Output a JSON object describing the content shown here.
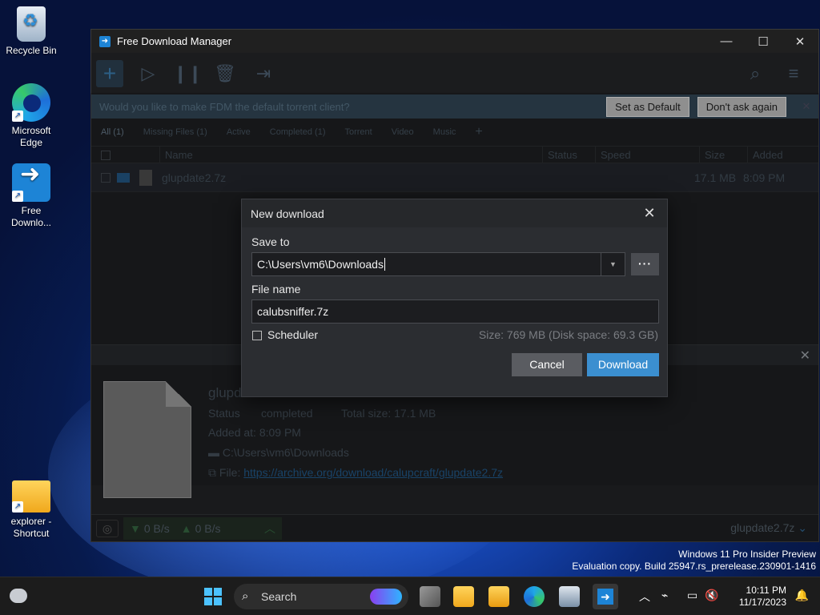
{
  "desktop": {
    "icons": [
      {
        "label": "Recycle Bin"
      },
      {
        "label": "Microsoft Edge"
      },
      {
        "label": "Free Downlo..."
      },
      {
        "label": "explorer - Shortcut"
      }
    ]
  },
  "window": {
    "title": "Free Download Manager",
    "notice": {
      "message": "Would you like to make FDM the default torrent client?",
      "set_default": "Set as Default",
      "dont_ask": "Don't ask again"
    },
    "tabs": [
      "All (1)",
      "Missing Files (1)",
      "Active",
      "Completed (1)",
      "Torrent",
      "Video",
      "Music"
    ],
    "columns": {
      "name": "Name",
      "status": "Status",
      "speed": "Speed",
      "size": "Size",
      "added": "Added"
    },
    "row": {
      "name": "glupdate2.7z",
      "size": "17.1 MB",
      "added": "8:09 PM"
    },
    "details": {
      "name": "glupdate2.7z",
      "status_label": "Status",
      "status_value": "completed",
      "total_size": "Total size: 17.1 MB",
      "added_at": "Added at: 8:09 PM",
      "path": "C:\\Users\\vm6\\Downloads",
      "file_label": "File:",
      "file_url": "https://archive.org/download/calupcraft/glupdate2.7z"
    },
    "status": {
      "down": "0 B/s",
      "up": "0 B/s",
      "current": "glupdate2.7z"
    }
  },
  "dialog": {
    "title": "New download",
    "save_to_label": "Save to",
    "save_to_value": "C:\\Users\\vm6\\Downloads",
    "file_name_label": "File name",
    "file_name_value": "calubsniffer.7z",
    "scheduler_label": "Scheduler",
    "size_info": "Size: 769 MB (Disk space: 69.3 GB)",
    "cancel": "Cancel",
    "download": "Download",
    "more": "···"
  },
  "watermark": {
    "line1": "Windows 11 Pro Insider Preview",
    "line2": "Evaluation copy. Build 25947.rs_prerelease.230901-1416"
  },
  "taskbar": {
    "search_label": "Search",
    "time": "10:11 PM",
    "date": "11/17/2023"
  }
}
